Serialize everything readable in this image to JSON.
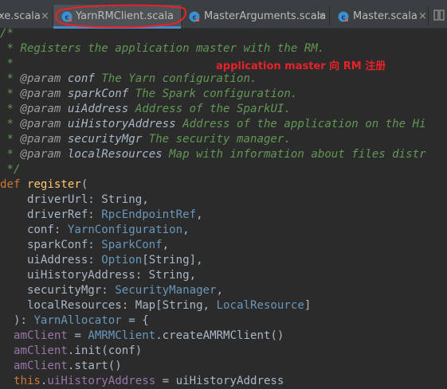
{
  "tabs": [
    {
      "label": "xe.scala",
      "active": false,
      "icon": "scala-class-icon"
    },
    {
      "label": "YarnRMClient.scala",
      "active": true,
      "icon": "scala-class-icon"
    },
    {
      "label": "MasterArguments.scala",
      "active": false,
      "icon": "scala-class-icon"
    },
    {
      "label": "Master.scala",
      "active": false,
      "icon": "scala-class-icon"
    }
  ],
  "tab_close_glyph": "×",
  "annotation": {
    "text": "application master 向 RM 注册",
    "color": "#e8222a"
  },
  "code_lines": [
    [
      {
        "t": "/*",
        "c": "doc"
      }
    ],
    [
      {
        "t": " * Registers the application master with the RM.",
        "c": "doc"
      }
    ],
    [
      {
        "t": " *",
        "c": "doc"
      }
    ],
    [
      {
        "t": " * ",
        "c": "doc"
      },
      {
        "t": "@param",
        "c": "doctag"
      },
      {
        "t": " conf",
        "c": "docparam"
      },
      {
        "t": " The Yarn configuration.",
        "c": "doc"
      }
    ],
    [
      {
        "t": " * ",
        "c": "doc"
      },
      {
        "t": "@param",
        "c": "doctag"
      },
      {
        "t": " sparkConf",
        "c": "docparam"
      },
      {
        "t": " The Spark configuration.",
        "c": "doc"
      }
    ],
    [
      {
        "t": " * ",
        "c": "doc"
      },
      {
        "t": "@param",
        "c": "doctag"
      },
      {
        "t": " uiAddress",
        "c": "docparam"
      },
      {
        "t": " Address of the SparkUI.",
        "c": "doc"
      }
    ],
    [
      {
        "t": " * ",
        "c": "doc"
      },
      {
        "t": "@param",
        "c": "doctag"
      },
      {
        "t": " uiHistoryAddress",
        "c": "docparam"
      },
      {
        "t": " Address of the application on the Hi",
        "c": "doc"
      }
    ],
    [
      {
        "t": " * ",
        "c": "doc"
      },
      {
        "t": "@param",
        "c": "doctag"
      },
      {
        "t": " securityMgr",
        "c": "docparam"
      },
      {
        "t": " The security manager.",
        "c": "doc"
      }
    ],
    [
      {
        "t": " * ",
        "c": "doc"
      },
      {
        "t": "@param",
        "c": "doctag"
      },
      {
        "t": " localResources",
        "c": "docparam"
      },
      {
        "t": " Map with information about files distr",
        "c": "doc"
      }
    ],
    [
      {
        "t": " */",
        "c": "doc"
      }
    ],
    [
      {
        "t": "def ",
        "c": "kw"
      },
      {
        "t": "register",
        "c": "fn"
      },
      {
        "t": "(",
        "c": "id"
      }
    ],
    [
      {
        "t": "    driverUrl: String,",
        "c": "id"
      }
    ],
    [
      {
        "t": "    driverRef: ",
        "c": "id"
      },
      {
        "t": "RpcEndpointRef",
        "c": "ty"
      },
      {
        "t": ",",
        "c": "id"
      }
    ],
    [
      {
        "t": "    conf: ",
        "c": "id"
      },
      {
        "t": "YarnConfiguration",
        "c": "ty"
      },
      {
        "t": ",",
        "c": "id"
      }
    ],
    [
      {
        "t": "    sparkConf: ",
        "c": "id"
      },
      {
        "t": "SparkConf",
        "c": "ty"
      },
      {
        "t": ",",
        "c": "id"
      }
    ],
    [
      {
        "t": "    uiAddress: ",
        "c": "id"
      },
      {
        "t": "Option",
        "c": "ty"
      },
      {
        "t": "[String],",
        "c": "id"
      }
    ],
    [
      {
        "t": "    uiHistoryAddress: String,",
        "c": "id"
      }
    ],
    [
      {
        "t": "    securityMgr: ",
        "c": "id"
      },
      {
        "t": "SecurityManager",
        "c": "ty"
      },
      {
        "t": ",",
        "c": "id"
      }
    ],
    [
      {
        "t": "    localResources: Map[String, ",
        "c": "id"
      },
      {
        "t": "LocalResource",
        "c": "ty"
      },
      {
        "t": "]",
        "c": "id"
      }
    ],
    [
      {
        "t": "  ): ",
        "c": "id"
      },
      {
        "t": "YarnAllocator",
        "c": "ty"
      },
      {
        "t": " = {",
        "c": "id"
      }
    ],
    [
      {
        "t": "  amClient",
        "c": "fld"
      },
      {
        "t": " = ",
        "c": "id"
      },
      {
        "t": "AMRMClient",
        "c": "ty"
      },
      {
        "t": ".createAMRMClient()",
        "c": "id"
      }
    ],
    [
      {
        "t": "  amClient",
        "c": "fld"
      },
      {
        "t": ".init(conf)",
        "c": "id"
      }
    ],
    [
      {
        "t": "  amClient",
        "c": "fld"
      },
      {
        "t": ".start()",
        "c": "id"
      }
    ],
    [
      {
        "t": "  this",
        "c": "kw"
      },
      {
        "t": ".",
        "c": "id"
      },
      {
        "t": "uiHistoryAddress",
        "c": "fld"
      },
      {
        "t": " = uiHistoryAddress",
        "c": "id"
      }
    ]
  ]
}
